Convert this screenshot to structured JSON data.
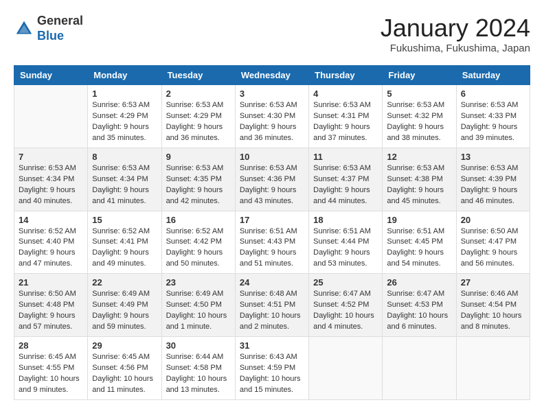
{
  "logo": {
    "general": "General",
    "blue": "Blue"
  },
  "header": {
    "month": "January 2024",
    "location": "Fukushima, Fukushima, Japan"
  },
  "weekdays": [
    "Sunday",
    "Monday",
    "Tuesday",
    "Wednesday",
    "Thursday",
    "Friday",
    "Saturday"
  ],
  "weeks": [
    [
      {
        "day": "",
        "info": ""
      },
      {
        "day": "1",
        "info": "Sunrise: 6:53 AM\nSunset: 4:29 PM\nDaylight: 9 hours\nand 35 minutes."
      },
      {
        "day": "2",
        "info": "Sunrise: 6:53 AM\nSunset: 4:29 PM\nDaylight: 9 hours\nand 36 minutes."
      },
      {
        "day": "3",
        "info": "Sunrise: 6:53 AM\nSunset: 4:30 PM\nDaylight: 9 hours\nand 36 minutes."
      },
      {
        "day": "4",
        "info": "Sunrise: 6:53 AM\nSunset: 4:31 PM\nDaylight: 9 hours\nand 37 minutes."
      },
      {
        "day": "5",
        "info": "Sunrise: 6:53 AM\nSunset: 4:32 PM\nDaylight: 9 hours\nand 38 minutes."
      },
      {
        "day": "6",
        "info": "Sunrise: 6:53 AM\nSunset: 4:33 PM\nDaylight: 9 hours\nand 39 minutes."
      }
    ],
    [
      {
        "day": "7",
        "info": ""
      },
      {
        "day": "8",
        "info": "Sunrise: 6:53 AM\nSunset: 4:34 PM\nDaylight: 9 hours\nand 41 minutes."
      },
      {
        "day": "9",
        "info": "Sunrise: 6:53 AM\nSunset: 4:35 PM\nDaylight: 9 hours\nand 42 minutes."
      },
      {
        "day": "10",
        "info": "Sunrise: 6:53 AM\nSunset: 4:36 PM\nDaylight: 9 hours\nand 43 minutes."
      },
      {
        "day": "11",
        "info": "Sunrise: 6:53 AM\nSunset: 4:37 PM\nDaylight: 9 hours\nand 44 minutes."
      },
      {
        "day": "12",
        "info": "Sunrise: 6:53 AM\nSunset: 4:38 PM\nDaylight: 9 hours\nand 45 minutes."
      },
      {
        "day": "13",
        "info": "Sunrise: 6:53 AM\nSunset: 4:39 PM\nDaylight: 9 hours\nand 46 minutes."
      }
    ],
    [
      {
        "day": "14",
        "info": ""
      },
      {
        "day": "15",
        "info": "Sunrise: 6:52 AM\nSunset: 4:41 PM\nDaylight: 9 hours\nand 49 minutes."
      },
      {
        "day": "16",
        "info": "Sunrise: 6:52 AM\nSunset: 4:42 PM\nDaylight: 9 hours\nand 50 minutes."
      },
      {
        "day": "17",
        "info": "Sunrise: 6:51 AM\nSunset: 4:43 PM\nDaylight: 9 hours\nand 51 minutes."
      },
      {
        "day": "18",
        "info": "Sunrise: 6:51 AM\nSunset: 4:44 PM\nDaylight: 9 hours\nand 53 minutes."
      },
      {
        "day": "19",
        "info": "Sunrise: 6:51 AM\nSunset: 4:45 PM\nDaylight: 9 hours\nand 54 minutes."
      },
      {
        "day": "20",
        "info": "Sunrise: 6:50 AM\nSunset: 4:47 PM\nDaylight: 9 hours\nand 56 minutes."
      }
    ],
    [
      {
        "day": "21",
        "info": ""
      },
      {
        "day": "22",
        "info": "Sunrise: 6:49 AM\nSunset: 4:49 PM\nDaylight: 9 hours\nand 59 minutes."
      },
      {
        "day": "23",
        "info": "Sunrise: 6:49 AM\nSunset: 4:50 PM\nDaylight: 10 hours\nand 1 minute."
      },
      {
        "day": "24",
        "info": "Sunrise: 6:48 AM\nSunset: 4:51 PM\nDaylight: 10 hours\nand 2 minutes."
      },
      {
        "day": "25",
        "info": "Sunrise: 6:47 AM\nSunset: 4:52 PM\nDaylight: 10 hours\nand 4 minutes."
      },
      {
        "day": "26",
        "info": "Sunrise: 6:47 AM\nSunset: 4:53 PM\nDaylight: 10 hours\nand 6 minutes."
      },
      {
        "day": "27",
        "info": "Sunrise: 6:46 AM\nSunset: 4:54 PM\nDaylight: 10 hours\nand 8 minutes."
      }
    ],
    [
      {
        "day": "28",
        "info": "Sunrise: 6:45 AM\nSunset: 4:55 PM\nDaylight: 10 hours\nand 9 minutes."
      },
      {
        "day": "29",
        "info": "Sunrise: 6:45 AM\nSunset: 4:56 PM\nDaylight: 10 hours\nand 11 minutes."
      },
      {
        "day": "30",
        "info": "Sunrise: 6:44 AM\nSunset: 4:58 PM\nDaylight: 10 hours\nand 13 minutes."
      },
      {
        "day": "31",
        "info": "Sunrise: 6:43 AM\nSunset: 4:59 PM\nDaylight: 10 hours\nand 15 minutes."
      },
      {
        "day": "",
        "info": ""
      },
      {
        "day": "",
        "info": ""
      },
      {
        "day": "",
        "info": ""
      }
    ]
  ],
  "week1_sunday": "Sunrise: 6:53 AM\nSunset: 4:34 PM\nDaylight: 9 hours\nand 40 minutes.",
  "week3_sunday": "Sunrise: 6:52 AM\nSunset: 4:40 PM\nDaylight: 9 hours\nand 47 minutes.",
  "week4_sunday": "Sunrise: 6:50 AM\nSunset: 4:48 PM\nDaylight: 9 hours\nand 57 minutes."
}
